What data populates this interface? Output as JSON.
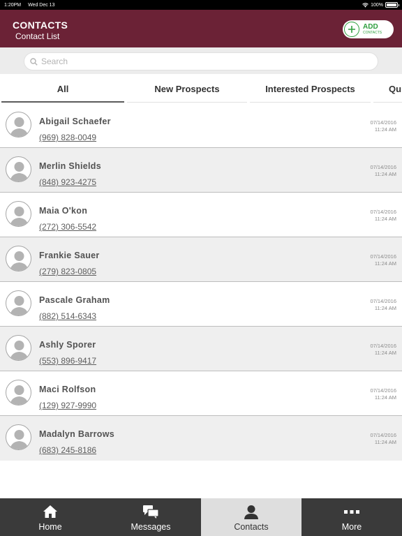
{
  "status_bar": {
    "time": "1:20PM",
    "date": "Wed Dec 13",
    "battery": "100%",
    "battery_level": 1.0
  },
  "header": {
    "title": "CONTACTS",
    "subtitle": "Contact List",
    "add_label": "ADD",
    "add_sublabel": "CONTACTS"
  },
  "search": {
    "placeholder": "Search"
  },
  "tabs": [
    {
      "label": "All",
      "active": true
    },
    {
      "label": "New Prospects",
      "active": false
    },
    {
      "label": "Interested Prospects",
      "active": false
    },
    {
      "label": "Qu",
      "active": false
    }
  ],
  "contacts": [
    {
      "name": "Abigail Schaefer",
      "phone": "(969) 828-0049",
      "date": "07/14/2016",
      "time": "11:24 AM"
    },
    {
      "name": "Merlin Shields",
      "phone": "(848) 923-4275",
      "date": "07/14/2016",
      "time": "11:24 AM"
    },
    {
      "name": "Maia O'kon",
      "phone": "(272) 306-5542",
      "date": "07/14/2016",
      "time": "11:24 AM"
    },
    {
      "name": "Frankie Sauer",
      "phone": "(279) 823-0805",
      "date": "07/14/2016",
      "time": "11:24 AM"
    },
    {
      "name": "Pascale Graham",
      "phone": "(882) 514-6343",
      "date": "07/14/2016",
      "time": "11:24 AM"
    },
    {
      "name": "Ashly Sporer",
      "phone": "(553) 896-9417",
      "date": "07/14/2016",
      "time": "11:24 AM"
    },
    {
      "name": "Maci Rolfson",
      "phone": "(129) 927-9990",
      "date": "07/14/2016",
      "time": "11:24 AM"
    },
    {
      "name": "Madalyn Barrows",
      "phone": "(683) 245-8186",
      "date": "07/14/2016",
      "time": "11:24 AM"
    }
  ],
  "bottom_nav": [
    {
      "label": "Home",
      "icon": "home-icon",
      "active": false
    },
    {
      "label": "Messages",
      "icon": "messages-icon",
      "active": false
    },
    {
      "label": "Contacts",
      "icon": "contacts-icon",
      "active": true
    },
    {
      "label": "More",
      "icon": "more-icon",
      "active": false
    }
  ],
  "colors": {
    "header_bg": "#6b2236",
    "add_green": "#2e9e3e",
    "nav_bg": "#3a3a3a",
    "nav_active_bg": "#dedede"
  }
}
